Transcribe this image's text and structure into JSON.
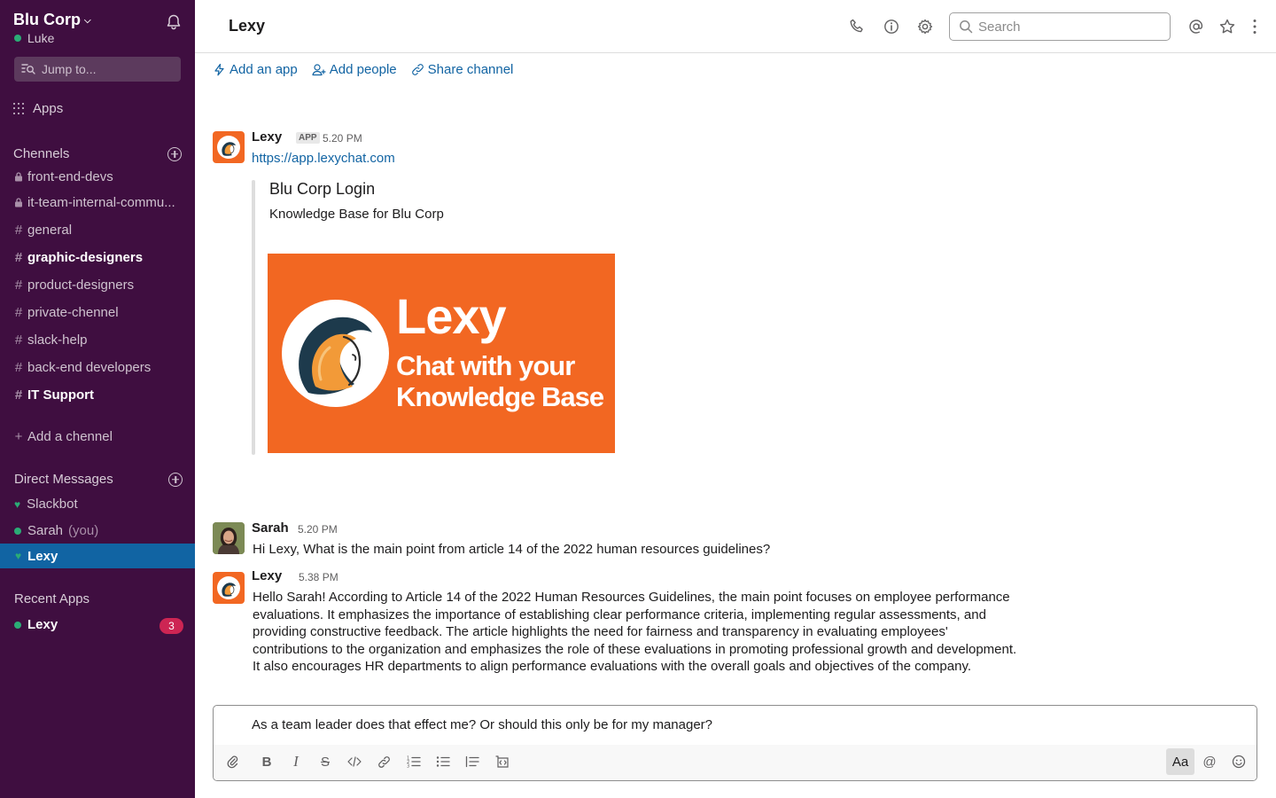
{
  "workspace": {
    "name": "Blu Corp",
    "user": "Luke",
    "jump_placeholder": "Jump to...",
    "apps_label": "Apps"
  },
  "channels": {
    "header": "Chennels",
    "items": [
      {
        "name": "front-end-devs",
        "locked": true,
        "bold": false
      },
      {
        "name": "it-team-internal-commu...",
        "locked": true,
        "bold": false
      },
      {
        "name": "general",
        "locked": false,
        "bold": false
      },
      {
        "name": "graphic-designers",
        "locked": false,
        "bold": true
      },
      {
        "name": "product-designers",
        "locked": false,
        "bold": false
      },
      {
        "name": "private-chennel",
        "locked": false,
        "bold": false
      },
      {
        "name": "slack-help",
        "locked": false,
        "bold": false
      },
      {
        "name": "back-end developers",
        "locked": false,
        "bold": false
      },
      {
        "name": "IT Support",
        "locked": false,
        "bold": true
      }
    ],
    "add_label": "Add a chennel"
  },
  "direct_messages": {
    "header": "Direct Messages",
    "items": [
      {
        "name": "Slackbot",
        "suffix": ""
      },
      {
        "name": "Sarah",
        "suffix": "(you)"
      },
      {
        "name": "Lexy",
        "suffix": "",
        "active": true
      }
    ]
  },
  "recent_apps": {
    "header": "Recent Apps",
    "items": [
      {
        "name": "Lexy",
        "badge": "3"
      }
    ]
  },
  "header": {
    "title": "Lexy",
    "search_placeholder": "Search"
  },
  "actions": {
    "add_app": "Add an app",
    "add_people": "Add people",
    "share_channel": "Share channel"
  },
  "messages": [
    {
      "author": "Lexy",
      "tag": "APP",
      "time": "5.20 PM",
      "link": "https://app.lexychat.com",
      "attachment": {
        "title": "Blu Corp Login",
        "description": "Knowledge Base for Blu Corp",
        "banner_title": "Lexy",
        "banner_line1": "Chat with your",
        "banner_line2": "Knowledge Base"
      }
    },
    {
      "author": "Sarah",
      "time": "5.20 PM",
      "text": "Hi Lexy, What is the main point from article 14 of the 2022 human resources guidelines?"
    },
    {
      "author": "Lexy",
      "time": "5.38 PM",
      "text": "Hello Sarah! According to Article 14 of the 2022 Human Resources Guidelines, the main point focuses on employee performance evaluations. It emphasizes the importance of establishing clear performance criteria, implementing regular assessments, and providing constructive feedback. The article highlights the need for fairness and transparency in evaluating employees' contributions to the organization and emphasizes the role of these evaluations in promoting professional growth and development. It also encourages HR departments to align performance evaluations with the overall goals and objectives of the company."
    }
  ],
  "composer": {
    "text": "As a team leader does that effect me? Or should this only be for my manager?",
    "format_label": "Aa",
    "mention_label": "@"
  },
  "colors": {
    "sidebar": "#3f0e40",
    "active": "#1164a3",
    "link": "#1264a3",
    "presence": "#2bac76",
    "badge": "#cd2553",
    "brand_orange": "#f26722"
  }
}
